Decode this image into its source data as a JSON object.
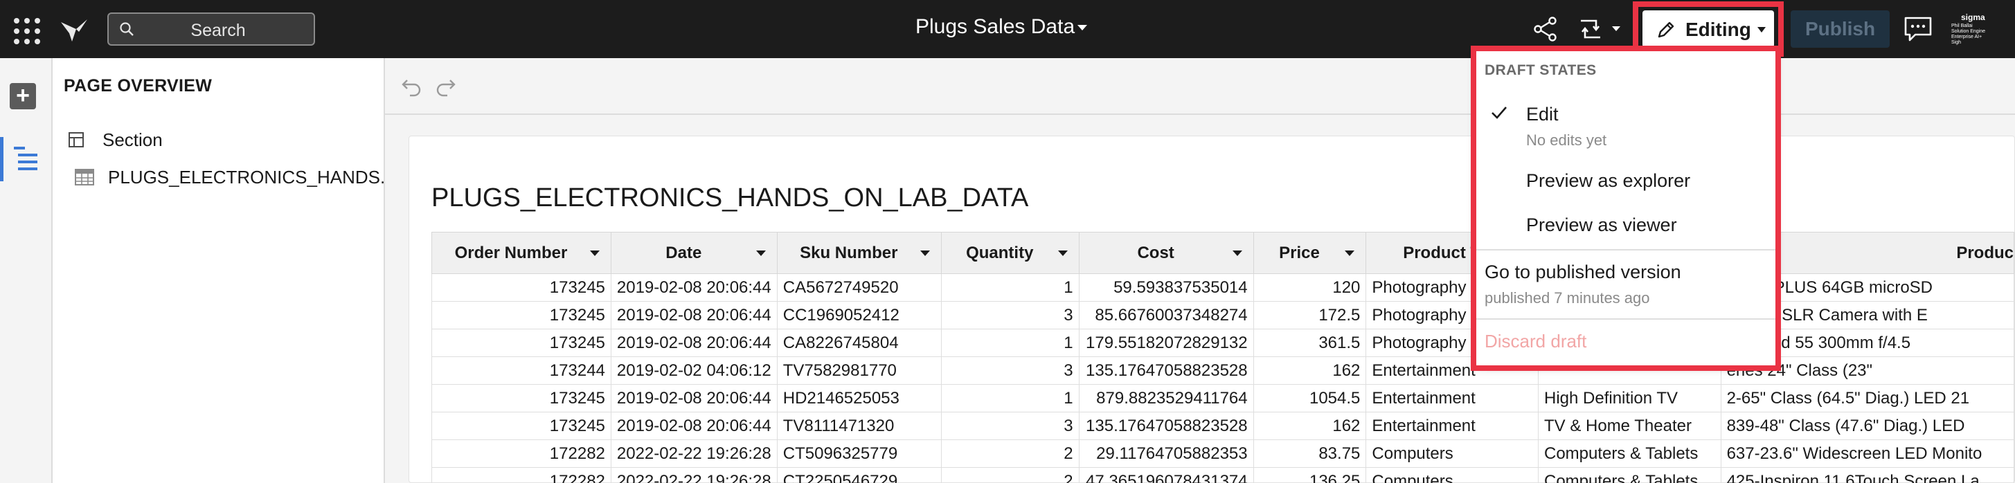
{
  "topbar": {
    "search_placeholder": "Search",
    "doc_title": "Plugs Sales Data",
    "editing_label": "Editing",
    "publish_label": "Publish",
    "org_brand": "sigma",
    "org_sub": "Phil Ballai Solution Engine Enterprise AI+ Sigh"
  },
  "overview": {
    "header": "PAGE OVERVIEW",
    "items": [
      {
        "label": "Section",
        "icon": "section-icon"
      },
      {
        "label": "PLUGS_ELECTRONICS_HANDS...",
        "icon": "table-icon"
      }
    ]
  },
  "table": {
    "title": "PLUGS_ELECTRONICS_HANDS_ON_LAB_DATA",
    "columns": [
      "Order Number",
      "Date",
      "Sku Number",
      "Quantity",
      "Cost",
      "Price",
      "Product T",
      "",
      "Produc"
    ],
    "rows": [
      [
        "173245",
        "2019-02-08 20:06:44",
        "CA5672749520",
        "1",
        "59.593837535014",
        "120",
        "Photography",
        "",
        "treme PLUS 64GB microSD"
      ],
      [
        "173245",
        "2019-02-08 20:06:44",
        "CC1969052412",
        "3",
        "85.66760037348274",
        "172.5",
        "Photography",
        "",
        "S T6i DSLR Camera with E"
      ],
      [
        "173245",
        "2019-02-08 20:06:44",
        "CA8226745804",
        "1",
        "179.55182072829132",
        "361.5",
        "Photography",
        "",
        "urbished  55 300mm f/4.5"
      ],
      [
        "173244",
        "2019-02-02 04:06:12",
        "TV7582981770",
        "3",
        "135.17647058823528",
        "162",
        "Entertainment",
        "",
        "eries   24\" Class (23\""
      ],
      [
        "173245",
        "2019-02-08 20:06:44",
        "HD2146525053",
        "1",
        "879.8823529411764",
        "1054.5",
        "Entertainment",
        "High Definition TV",
        "2-65\" Class (64.5\" Diag.)   LED   21"
      ],
      [
        "173245",
        "2019-02-08 20:06:44",
        "TV8111471320",
        "3",
        "135.17647058823528",
        "162",
        "Entertainment",
        "TV & Home Theater",
        "839-48\" Class (47.6\" Diag.)   LED"
      ],
      [
        "172282",
        "2022-02-22 19:26:28",
        "CT5096325779",
        "2",
        "29.11764705882353",
        "83.75",
        "Computers",
        "Computers & Tablets",
        "637-23.6\" Widescreen LED Monito"
      ],
      [
        "172282",
        "2022-02-22 19:26:28",
        "CT2250546729",
        "2",
        "47.365196078431374",
        "136.25",
        "Computers",
        "Computers & Tablets",
        "425-Inspiron 11.6Touch Screen La"
      ]
    ]
  },
  "menu": {
    "section_label": "DRAFT STATES",
    "edit_label": "Edit",
    "edit_sub": "No edits yet",
    "preview_explorer": "Preview as explorer",
    "preview_viewer": "Preview as viewer",
    "go_published": "Go to published version",
    "published_sub": "published 7 minutes ago",
    "discard": "Discard draft"
  },
  "colors": {
    "topbar_bg": "#1c1c1c",
    "highlight": "#ea3344",
    "publish_bg": "#1f3140",
    "accent": "#3c7ad6"
  }
}
